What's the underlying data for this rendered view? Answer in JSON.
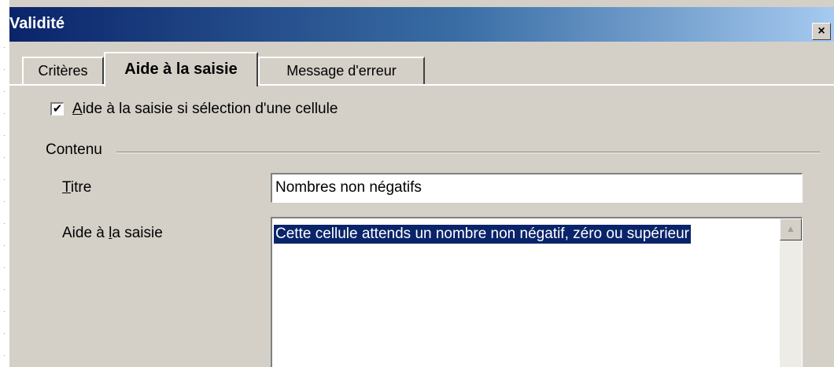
{
  "window": {
    "title": "Validité",
    "close_glyph": "×"
  },
  "tabs": [
    {
      "label": "Critères",
      "active": false
    },
    {
      "label": "Aide à la saisie",
      "active": true
    },
    {
      "label": "Message d'erreur",
      "active": false
    }
  ],
  "panel": {
    "enable_checkbox": {
      "checked": true,
      "glyph": "✔",
      "label_mnemonic": "A",
      "label_rest": "ide à la saisie si sélection d'une cellule"
    },
    "group_title": "Contenu",
    "title_field": {
      "label_mnemonic": "T",
      "label_rest": "itre",
      "value": "Nombres non négatifs"
    },
    "help_field": {
      "label_before": "Aide à ",
      "label_mnemonic": "l",
      "label_after": "a saisie",
      "value": "Cette cellule attends un nombre non négatif, zéro ou supérieur"
    },
    "scroll_up_glyph": "▲"
  },
  "colors": {
    "titlebar_start": "#0a246a",
    "titlebar_end": "#a6caf0",
    "dialog_bg": "#d4d0c8",
    "selection": "#0a246a"
  }
}
